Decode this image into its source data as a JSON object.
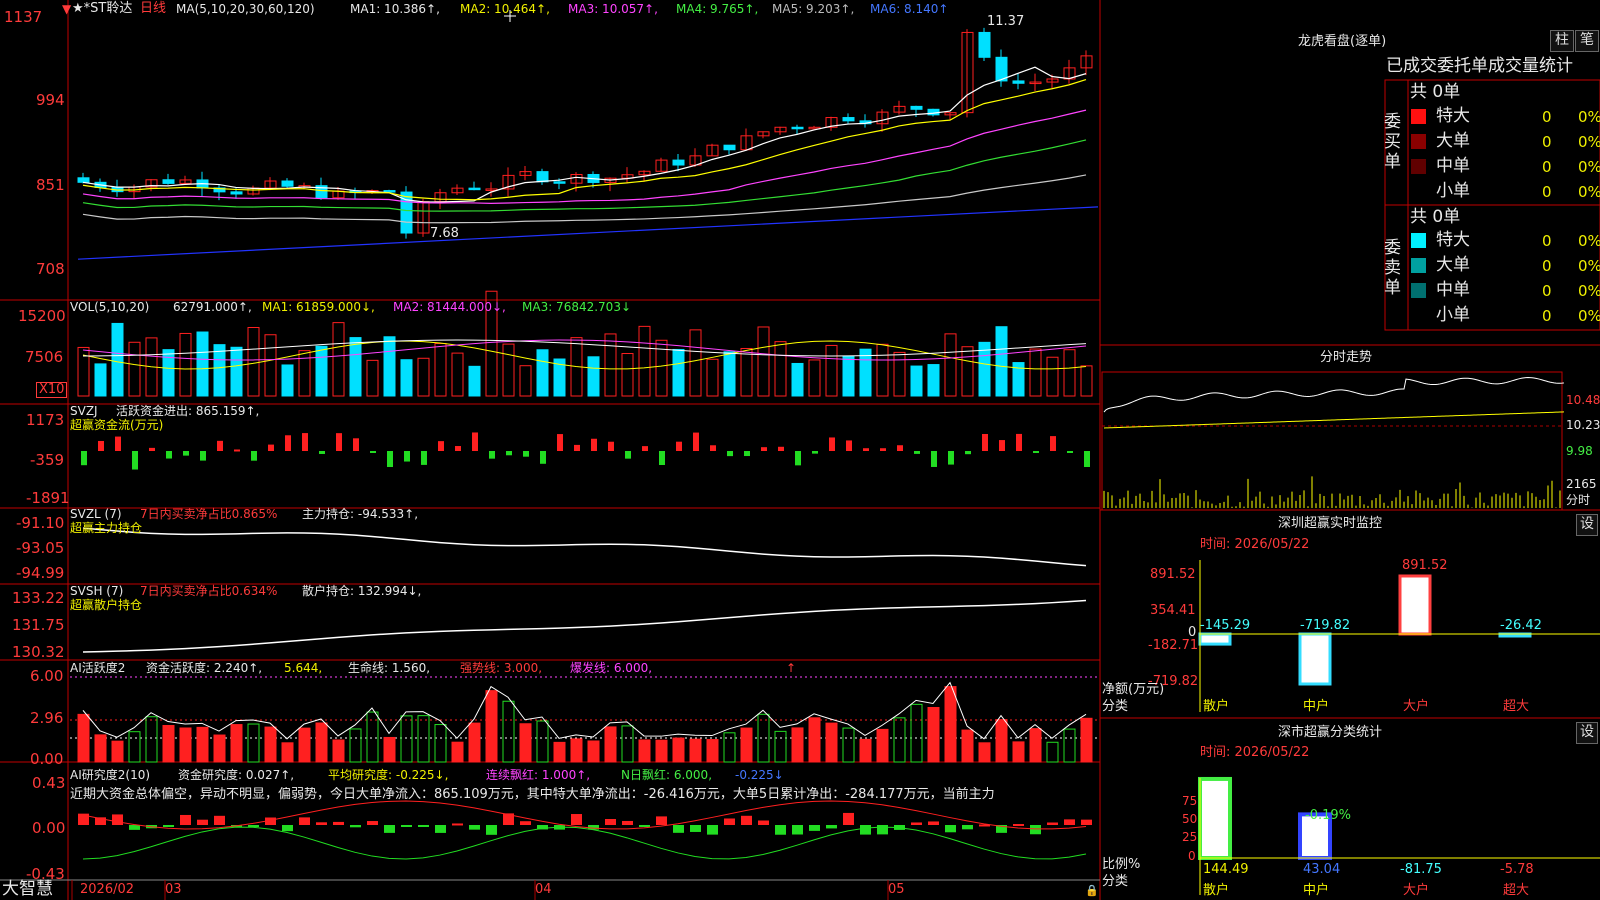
{
  "colors": {
    "up": "#ff2020",
    "down": "#00e0ff",
    "grid": "#c00000",
    "ma1": "#ffffff",
    "ma2": "#ffff00",
    "ma3": "#ff44ff",
    "ma4": "#33dd33",
    "ma5": "#c8c8c8",
    "ma6": "#2233ff"
  },
  "icons": {
    "window_menu": "triangle-marker-icon",
    "chart_marker": "cross-marker-icon",
    "lock": "lock-icon"
  },
  "price_panel": {
    "title": "★*ST聆达",
    "period": "日线",
    "ma_params": "MA(5,10,20,30,60,120)",
    "ma1": "MA1: 10.386↑,",
    "ma2": "MA2: 10.464↑,",
    "ma3": "MA3: 10.057↑,",
    "ma4": "MA4: 9.765↑,",
    "ma5": "MA5: 9.203↑,",
    "ma6": "MA6: 8.140↑",
    "y_labels": [
      "1137",
      "994",
      "851",
      "708"
    ],
    "high_label": "11.37",
    "low_label": "7.68"
  },
  "vol_panel": {
    "params": "VOL(5,10,20)",
    "val": "62791.000↑,",
    "ma1": "MA1: 61859.000↓,",
    "ma2": "MA2: 81444.000↓,",
    "ma3": "MA3: 76842.703↓",
    "y_labels": [
      "15200",
      "7506"
    ],
    "unit": "X10"
  },
  "svzj": {
    "name": "SVZJ",
    "text": "活跃资金进出: 865.159↑,",
    "sub": "超赢资金流(万元)",
    "y_labels": [
      "1173",
      "-359",
      "-1891"
    ]
  },
  "svzl": {
    "name": "SVZL (7)",
    "ratio": "7日内买卖净占比0.865%",
    "text": "主力持仓: -94.533↑,",
    "sub": "超赢主力持仓",
    "y_labels": [
      "-91.10",
      "-93.05",
      "-94.99"
    ]
  },
  "svsh": {
    "name": "SVSH (7)",
    "ratio": "7日内买卖净占比0.634%",
    "text": "散户持仓: 132.994↓,",
    "sub": "超赢散户持仓",
    "y_labels": [
      "133.22",
      "131.75",
      "130.32"
    ]
  },
  "ai_active": {
    "name": "AI活跃度2",
    "a": "资金活跃度: 2.240↑,",
    "b": "5.644,",
    "c": "生命线: 1.560,",
    "d": "强势线: 3.000,",
    "e": "爆发线: 6.000,",
    "f": "↑",
    "y_labels": [
      "6.00",
      "2.96",
      "0.00"
    ]
  },
  "ai_research": {
    "name": "AI研究度2(10)",
    "a": "资金研究度: 0.027↑,",
    "b": "平均研究度: -0.225↓,",
    "c": "连续飘红: 1.000↑,",
    "d": "N日飘红: 6.000,",
    "e": "-0.225↓",
    "comment": "近期大资金总体偏空，异动不明显，偏弱势，今日大单净流入：865.109万元，其中特大单净流出：-26.416万元，大单5日累计净出：-284.177万元，当前主力",
    "y_labels": [
      "0.43",
      "0.00",
      "-0.43"
    ]
  },
  "bottom_bar": {
    "brand": "大智慧",
    "dates": [
      "2026/02",
      "03",
      "04",
      "05"
    ]
  },
  "lhb": {
    "title": "龙虎看盘(逐单)",
    "btn1": "柱",
    "btn2": "笔",
    "subtitle": "已成交委托单成交量统计",
    "buy_total": "共 0单",
    "buy_label": "委买单",
    "sell_total": "共 0单",
    "sell_label": "委卖单",
    "buy_rows": [
      {
        "label": "特大",
        "v": "0",
        "p": "0%",
        "color": "#ff1010"
      },
      {
        "label": "大单",
        "v": "0",
        "p": "0%",
        "color": "#8a0000"
      },
      {
        "label": "中单",
        "v": "0",
        "p": "0%",
        "color": "#600000"
      },
      {
        "label": "小单",
        "v": "0",
        "p": "0%",
        "color": ""
      }
    ],
    "sell_rows": [
      {
        "label": "特大",
        "v": "0",
        "p": "0%",
        "color": "#00f0ff"
      },
      {
        "label": "大单",
        "v": "0",
        "p": "0%",
        "color": "#00a0a0"
      },
      {
        "label": "中单",
        "v": "0",
        "p": "0%",
        "color": "#007070"
      },
      {
        "label": "小单",
        "v": "0",
        "p": "0%",
        "color": ""
      }
    ]
  },
  "intraday": {
    "title": "分时走势",
    "y_labels": [
      "10.48",
      "10.23",
      "9.98"
    ],
    "vol_label": "2165",
    "vol_unit": "分时"
  },
  "sz_monitor": {
    "title": "深圳超赢实时监控",
    "btn": "设",
    "time": "时间: 2026/05/22",
    "y_labels": [
      "891.52",
      "354.41",
      "0",
      "-182.71",
      "-719.82"
    ],
    "ylabel": "净额(万元)",
    "xlabel": "分类",
    "cats": [
      "散户",
      "中户",
      "大户",
      "超大"
    ],
    "values": [
      -145.29,
      -719.82,
      891.52,
      -26.42
    ],
    "value_labels": [
      "-145.29",
      "-719.82",
      "891.52",
      "-26.42"
    ]
  },
  "sz_class": {
    "title": "深市超赢分类统计",
    "btn": "设",
    "time": "时间: 2026/05/22",
    "y_labels": [
      "75",
      "50",
      "25",
      "0"
    ],
    "ylabel": "比例%",
    "xlabel": "分类",
    "cats": [
      "散户",
      "中户",
      "大户",
      "超大"
    ],
    "values": [
      144.49,
      43.04,
      -81.75,
      -5.78
    ],
    "value_labels": [
      "144.49",
      "43.04",
      "-81.75",
      "-5.78"
    ],
    "extra": "-0.19%"
  },
  "chart_data": [
    {
      "type": "bar",
      "title": "深圳超赢实时监控",
      "categories": [
        "散户",
        "中户",
        "大户",
        "超大"
      ],
      "values": [
        -145.29,
        -719.82,
        891.52,
        -26.42
      ],
      "xlabel": "分类",
      "ylabel": "净额(万元)",
      "ylim": [
        -719.82,
        891.52
      ]
    },
    {
      "type": "bar",
      "title": "深市超赢分类统计",
      "categories": [
        "散户",
        "中户",
        "大户",
        "超大"
      ],
      "values": [
        144.49,
        43.04,
        -81.75,
        -5.78
      ],
      "xlabel": "分类",
      "ylabel": "比例%",
      "ylim": [
        0,
        75
      ]
    }
  ]
}
